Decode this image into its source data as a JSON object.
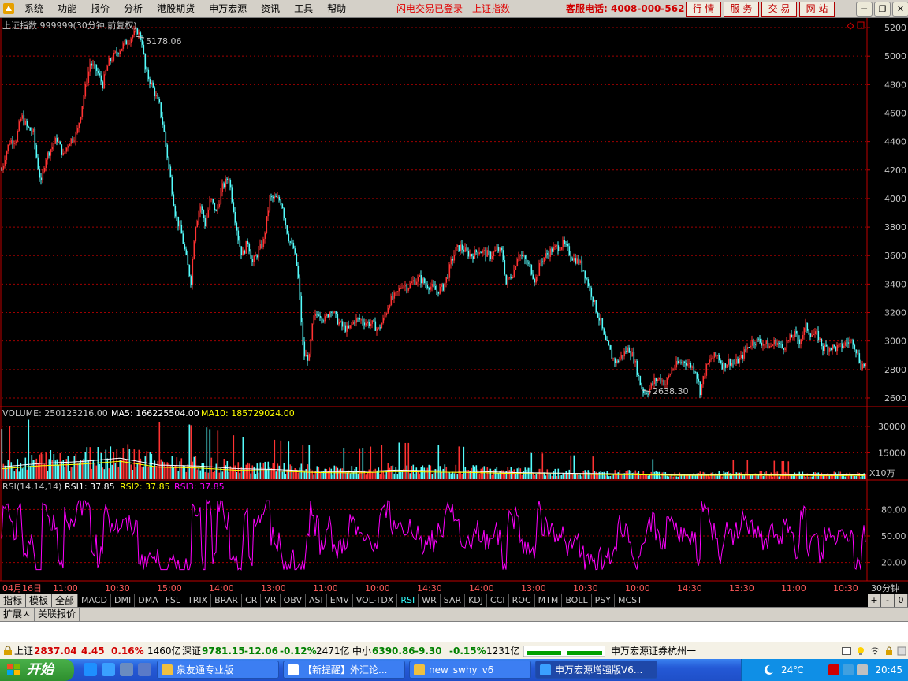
{
  "menubar": {
    "items": [
      "系统",
      "功能",
      "报价",
      "分析",
      "港股期货",
      "申万宏源",
      "资讯",
      "工具",
      "帮助"
    ],
    "status_login": "闪电交易已登录",
    "status_index": "上证指数",
    "hotline": "客服电话: 4008-000-562",
    "nav_buttons": [
      "行 情",
      "服 务",
      "交 易",
      "网 站"
    ],
    "window_buttons": [
      "─",
      "❐",
      "✕"
    ]
  },
  "chart_header": {
    "title": "上证指数 999999(30分钟,前复权)",
    "high_label": "5178.06",
    "low_label": "2638.30"
  },
  "volume_header": {
    "label": "VOLUME: 250123216.00",
    "ma5": "MA5: 166225504.00",
    "ma10": "MA10: 185729024.00",
    "unit": "X10万"
  },
  "rsi_header": {
    "label": "RSI(14,14,14)",
    "rsi1": "RSI1: 37.85",
    "rsi2": "RSI2: 37.85",
    "rsi3": "RSI3: 37.85"
  },
  "time_axis": {
    "labels": [
      "04月16日",
      "11:00",
      "10:30",
      "15:00",
      "14:00",
      "13:00",
      "11:00",
      "10:00",
      "14:30",
      "14:00",
      "13:00",
      "10:30",
      "10:00",
      "14:30",
      "13:30",
      "11:00",
      "10:30"
    ],
    "period": "30分钟"
  },
  "indicator_tabs": {
    "header": [
      "指标",
      "模板",
      "全部"
    ],
    "items": [
      "MACD",
      "DMI",
      "DMA",
      "FSL",
      "TRIX",
      "BRAR",
      "CR",
      "VR",
      "OBV",
      "ASI",
      "EMV",
      "VOL-TDX",
      "RSI",
      "WR",
      "SAR",
      "KDJ",
      "CCI",
      "ROC",
      "MTM",
      "BOLL",
      "PSY",
      "MCST"
    ],
    "active": "RSI",
    "controls": [
      "+",
      "-",
      "0"
    ]
  },
  "extension_tabs": [
    "扩展ㅅ",
    "关联报价"
  ],
  "statusbar": {
    "sh_name": "上证",
    "sh_value": "2837.04",
    "sh_change": "4.45",
    "sh_pct": "0.16%",
    "sh_amount": "1460亿",
    "sz_name": "深证",
    "sz_value": "9781.15",
    "sz_change": "-12.06",
    "sz_pct": "-0.12%",
    "sz_amount": "2471亿",
    "zx_name": "中小",
    "zx_value": "6390.86",
    "zx_change": "-9.30",
    "zx_pct": "-0.15%",
    "zx_amount": "1231亿",
    "broker": "申万宏源证券杭州一"
  },
  "taskbar": {
    "start_label": "开始",
    "tasks": [
      "泉友通专业版",
      "【新提醒】外汇论...",
      "new_swhy_v6",
      "申万宏源增强版V6..."
    ],
    "temperature": "24℃",
    "clock": "20:45"
  },
  "colors": {
    "up": "#ff3232",
    "down": "#54fcfc",
    "ma5": "#ffffff",
    "ma10": "#ffff00",
    "rsi": "#ff00ff",
    "grid": "#a00000"
  },
  "chart_data": [
    {
      "type": "candlestick",
      "title": "上证指数 999999(30分钟,前复权)",
      "ylim": [
        2550,
        5250
      ],
      "yticks": [
        2600,
        2800,
        3000,
        3200,
        3400,
        3600,
        3800,
        4000,
        4200,
        4400,
        4600,
        4800,
        5000,
        5200
      ],
      "close_path": [
        [
          0,
          4200
        ],
        [
          5,
          4320
        ],
        [
          10,
          4400
        ],
        [
          18,
          4420
        ],
        [
          25,
          4580
        ],
        [
          32,
          4500
        ],
        [
          40,
          4460
        ],
        [
          45,
          4250
        ],
        [
          50,
          4100
        ],
        [
          55,
          4280
        ],
        [
          62,
          4350
        ],
        [
          70,
          4420
        ],
        [
          78,
          4300
        ],
        [
          85,
          4400
        ],
        [
          95,
          4450
        ],
        [
          105,
          4750
        ],
        [
          112,
          4950
        ],
        [
          120,
          4900
        ],
        [
          128,
          4800
        ],
        [
          135,
          4950
        ],
        [
          145,
          5020
        ],
        [
          155,
          5080
        ],
        [
          165,
          5140
        ],
        [
          172,
          5178.06
        ],
        [
          178,
          5100
        ],
        [
          182,
          4900
        ],
        [
          190,
          4800
        ],
        [
          200,
          4650
        ],
        [
          205,
          4500
        ],
        [
          210,
          4300
        ],
        [
          215,
          4100
        ],
        [
          220,
          3900
        ],
        [
          228,
          3750
        ],
        [
          235,
          3550
        ],
        [
          240,
          3420
        ],
        [
          245,
          3800
        ],
        [
          252,
          3950
        ],
        [
          258,
          3820
        ],
        [
          265,
          4000
        ],
        [
          272,
          3900
        ],
        [
          280,
          4080
        ],
        [
          288,
          4150
        ],
        [
          292,
          4000
        ],
        [
          300,
          3720
        ],
        [
          305,
          3600
        ],
        [
          312,
          3700
        ],
        [
          318,
          3550
        ],
        [
          325,
          3620
        ],
        [
          332,
          3700
        ],
        [
          340,
          4000
        ],
        [
          348,
          4000
        ],
        [
          355,
          3980
        ],
        [
          360,
          3820
        ],
        [
          365,
          3700
        ],
        [
          370,
          3650
        ],
        [
          375,
          3500
        ],
        [
          378,
          3300
        ],
        [
          383,
          2900
        ],
        [
          390,
          2880
        ],
        [
          395,
          3150
        ],
        [
          402,
          3200
        ],
        [
          410,
          3150
        ],
        [
          418,
          3230
        ],
        [
          425,
          3150
        ],
        [
          432,
          3100
        ],
        [
          440,
          3080
        ],
        [
          448,
          3150
        ],
        [
          455,
          3150
        ],
        [
          462,
          3130
        ],
        [
          470,
          3120
        ],
        [
          478,
          3080
        ],
        [
          485,
          3160
        ],
        [
          492,
          3280
        ],
        [
          500,
          3320
        ],
        [
          508,
          3400
        ],
        [
          515,
          3380
        ],
        [
          522,
          3420
        ],
        [
          530,
          3440
        ],
        [
          538,
          3400
        ],
        [
          545,
          3380
        ],
        [
          552,
          3350
        ],
        [
          560,
          3380
        ],
        [
          565,
          3450
        ],
        [
          570,
          3550
        ],
        [
          576,
          3640
        ],
        [
          582,
          3660
        ],
        [
          590,
          3620
        ],
        [
          597,
          3600
        ],
        [
          605,
          3640
        ],
        [
          612,
          3620
        ],
        [
          620,
          3600
        ],
        [
          628,
          3640
        ],
        [
          635,
          3620
        ],
        [
          640,
          3400
        ],
        [
          645,
          3450
        ],
        [
          650,
          3500
        ],
        [
          655,
          3620
        ],
        [
          662,
          3580
        ],
        [
          670,
          3520
        ],
        [
          677,
          3420
        ],
        [
          684,
          3560
        ],
        [
          690,
          3600
        ],
        [
          698,
          3640
        ],
        [
          705,
          3660
        ],
        [
          712,
          3680
        ],
        [
          718,
          3640
        ],
        [
          725,
          3580
        ],
        [
          732,
          3560
        ],
        [
          738,
          3500
        ],
        [
          744,
          3400
        ],
        [
          750,
          3300
        ],
        [
          755,
          3200
        ],
        [
          760,
          3130
        ],
        [
          765,
          3000
        ],
        [
          770,
          2950
        ],
        [
          775,
          2880
        ],
        [
          780,
          2850
        ],
        [
          787,
          2900
        ],
        [
          795,
          2950
        ],
        [
          802,
          2880
        ],
        [
          810,
          2700
        ],
        [
          815,
          2640
        ],
        [
          820,
          2650
        ],
        [
          828,
          2720
        ],
        [
          835,
          2740
        ],
        [
          842,
          2700
        ],
        [
          850,
          2800
        ],
        [
          858,
          2840
        ],
        [
          866,
          2860
        ],
        [
          873,
          2830
        ],
        [
          880,
          2800
        ],
        [
          886,
          2650
        ],
        [
          893,
          2800
        ],
        [
          900,
          2880
        ],
        [
          908,
          2900
        ],
        [
          915,
          2820
        ],
        [
          922,
          2860
        ],
        [
          930,
          2840
        ],
        [
          938,
          2880
        ],
        [
          945,
          2950
        ],
        [
          952,
          3000
        ],
        [
          960,
          3000
        ],
        [
          968,
          2980
        ],
        [
          975,
          2960
        ],
        [
          982,
          3000
        ],
        [
          990,
          2950
        ],
        [
          998,
          3000
        ],
        [
          1005,
          3050
        ],
        [
          1012,
          3000
        ],
        [
          1020,
          3100
        ],
        [
          1027,
          3050
        ],
        [
          1035,
          3040
        ],
        [
          1042,
          2950
        ],
        [
          1050,
          2960
        ],
        [
          1058,
          2950
        ],
        [
          1065,
          2960
        ],
        [
          1072,
          2990
        ],
        [
          1080,
          3000
        ],
        [
          1085,
          2920
        ],
        [
          1090,
          2830
        ],
        [
          1097,
          2837.04
        ]
      ]
    },
    {
      "type": "bar",
      "title": "VOLUME",
      "unit": "X10万",
      "ylim": [
        0,
        34000
      ],
      "yticks": [
        15000,
        30000
      ],
      "series": [
        {
          "name": "MA5",
          "values": [
            166225504
          ]
        },
        {
          "name": "MA10",
          "values": [
            185729024
          ]
        }
      ],
      "value_path": [
        [
          0,
          7000
        ],
        [
          50,
          9000
        ],
        [
          100,
          10000
        ],
        [
          150,
          12000
        ],
        [
          200,
          8000
        ],
        [
          250,
          7500
        ],
        [
          300,
          6000
        ],
        [
          350,
          5500
        ],
        [
          400,
          4500
        ],
        [
          450,
          4200
        ],
        [
          500,
          5200
        ],
        [
          550,
          4800
        ],
        [
          600,
          4500
        ],
        [
          650,
          3800
        ],
        [
          700,
          3500
        ],
        [
          750,
          3200
        ],
        [
          800,
          3000
        ],
        [
          850,
          2600
        ],
        [
          900,
          2600
        ],
        [
          950,
          2700
        ],
        [
          1000,
          2500
        ],
        [
          1050,
          2400
        ],
        [
          1097,
          2500
        ]
      ]
    },
    {
      "type": "line",
      "title": "RSI(14,14,14)",
      "ylim": [
        0,
        100
      ],
      "yticks": [
        20,
        50,
        80
      ],
      "series": [
        {
          "name": "RSI1",
          "values": [
            37.85
          ]
        },
        {
          "name": "RSI2",
          "values": [
            37.85
          ]
        },
        {
          "name": "RSI3",
          "values": [
            37.85
          ]
        }
      ]
    }
  ]
}
